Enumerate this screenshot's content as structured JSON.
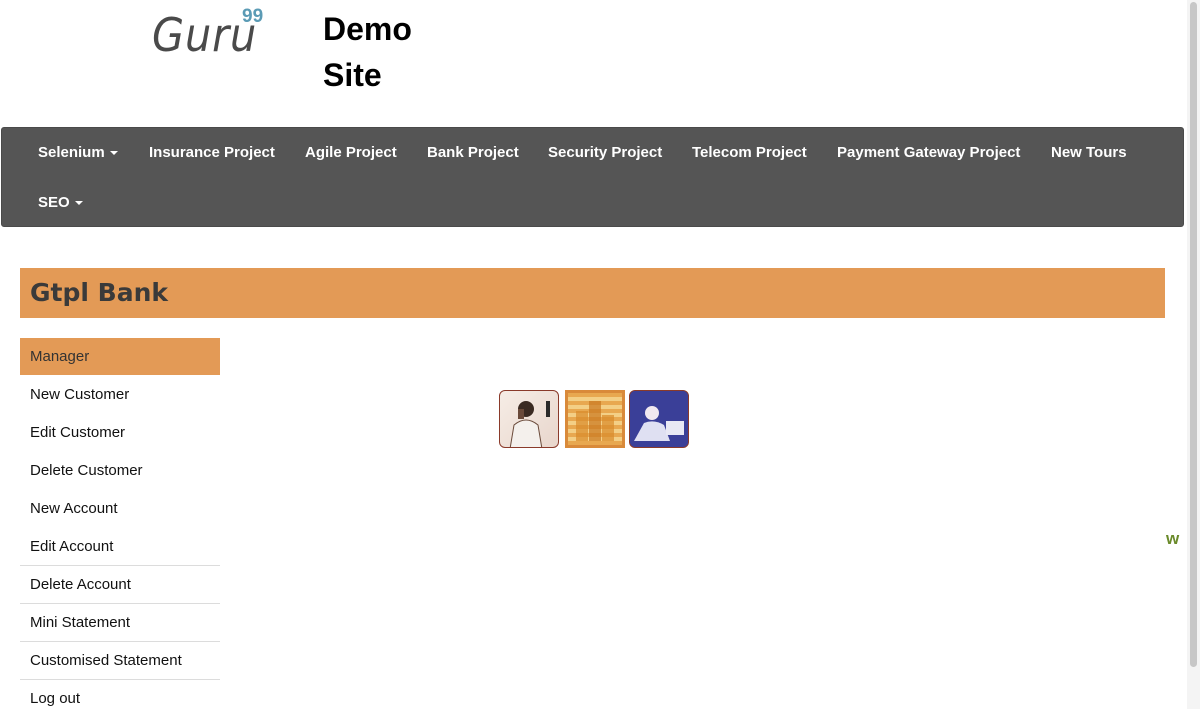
{
  "header": {
    "logo_text": "Guru",
    "logo_sup": "99",
    "site_title": "Demo Site"
  },
  "navbar": {
    "items": [
      {
        "label": "Selenium",
        "dropdown": true
      },
      {
        "label": "Insurance Project",
        "dropdown": false
      },
      {
        "label": "Agile Project",
        "dropdown": false
      },
      {
        "label": "Bank Project",
        "dropdown": false
      },
      {
        "label": "Security Project",
        "dropdown": false
      },
      {
        "label": "Telecom Project",
        "dropdown": false
      },
      {
        "label": "Payment Gateway Project",
        "dropdown": false
      },
      {
        "label": "New Tours",
        "dropdown": false
      },
      {
        "label": "SEO",
        "dropdown": true
      }
    ]
  },
  "banner": {
    "title": "Gtpl Bank"
  },
  "menu": {
    "items": [
      {
        "label": "Manager"
      },
      {
        "label": "New Customer"
      },
      {
        "label": "Edit Customer"
      },
      {
        "label": "Delete Customer"
      },
      {
        "label": "New Account"
      },
      {
        "label": "Edit Account"
      },
      {
        "label": "Delete Account"
      },
      {
        "label": "Mini Statement"
      },
      {
        "label": "Customised Statement"
      },
      {
        "label": "Log out"
      }
    ]
  },
  "side_mark": "w",
  "colors": {
    "navbar_bg": "#555555",
    "accent_orange": "#e39a56",
    "logo_sup": "#5b9bb5"
  }
}
